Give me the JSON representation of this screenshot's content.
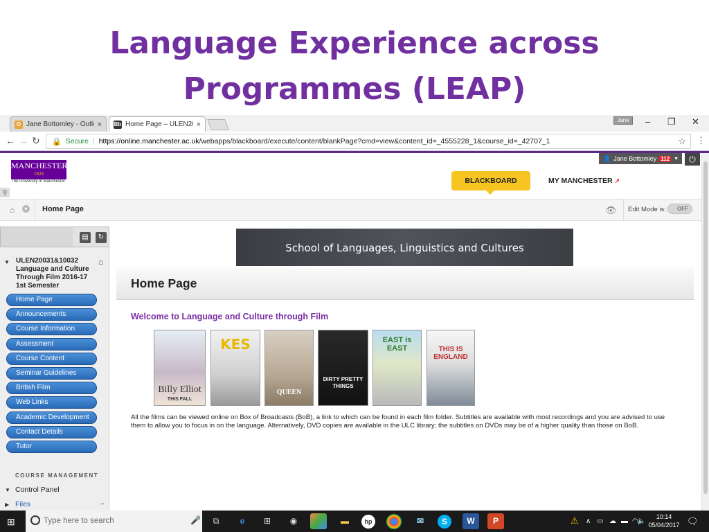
{
  "slide": {
    "title_line1": "Language Experience across",
    "title_line2": "Programmes (LEAP)"
  },
  "browser": {
    "tabs": [
      {
        "label": "Jane Bottomley - Outloo",
        "icon": "outlook-icon",
        "close": "×"
      },
      {
        "label": "Home Page – ULEN2003",
        "icon": "blackboard-icon",
        "close": "×"
      }
    ],
    "profile_chip": "Jane",
    "window_controls": {
      "minimize": "–",
      "restore": "❐",
      "close": "✕"
    },
    "secure_label": "Secure",
    "url_host": "https://online.manchester.ac.uk",
    "url_path": "/webapps/blackboard/execute/content/blankPage?cmd=view&content_id=_4555228_1&course_id=_42707_1",
    "bookmark_star": "☆",
    "menu_glyph": "⋮"
  },
  "header": {
    "logo_text": "MANCHESTER",
    "logo_year": "1824",
    "logo_sub": "The University of Manchester",
    "user_name": "Jane Bottomley",
    "notification_count": "112",
    "tabs": {
      "blackboard": "BLACKBOARD",
      "my_manchester": "MY MANCHESTER"
    },
    "power": "⏻"
  },
  "breadcrumb": {
    "label": "Home Page",
    "edit_mode_label": "Edit Mode is:",
    "edit_mode_value": "OFF"
  },
  "sidebar": {
    "course_title": "ULEN20031&10032 Language and Culture Through Film 2016-17 1st Semester",
    "menu": [
      "Home Page",
      "Announcements",
      "Course Information",
      "Assessment",
      "Course Content",
      "Seminar Guidelines",
      "British Film",
      "Web Links",
      "Academic Development",
      "Contact Details",
      "Tutor"
    ],
    "management_heading": "COURSE MANAGEMENT",
    "control_panel": "Control Panel",
    "files": "Files"
  },
  "content": {
    "banner": "School of Languages, Linguistics and Cultures",
    "page_title": "Home Page",
    "welcome": "Welcome to Language and Culture through Film",
    "posters": [
      {
        "title": "Billy Elliot",
        "tag": "THIS FALL"
      },
      {
        "title": "KES"
      },
      {
        "title": "QUEEN"
      },
      {
        "title": "DIRTY PRETTY THINGS"
      },
      {
        "title": "EAST is EAST"
      },
      {
        "title": "THIS IS ENGLAND"
      }
    ],
    "description": "All the films can be viewed online on Box of Broadcasts (BoB), a link to which can be found in each film folder. Subtitles are available with most recordings and you are advised to use them to allow you to focus in on the language. Alternatively, DVD copies are available in the ULC library; the subtitles on DVDs may be of a higher quality than those on BoB."
  },
  "taskbar": {
    "search_placeholder": "Type here to search",
    "time": "10:14",
    "date": "05/04/2017"
  },
  "colors": {
    "title": "#7030a0",
    "accent": "#f7c521",
    "menu_blue": "#2a6bb8",
    "welcome": "#7b2fa6"
  }
}
